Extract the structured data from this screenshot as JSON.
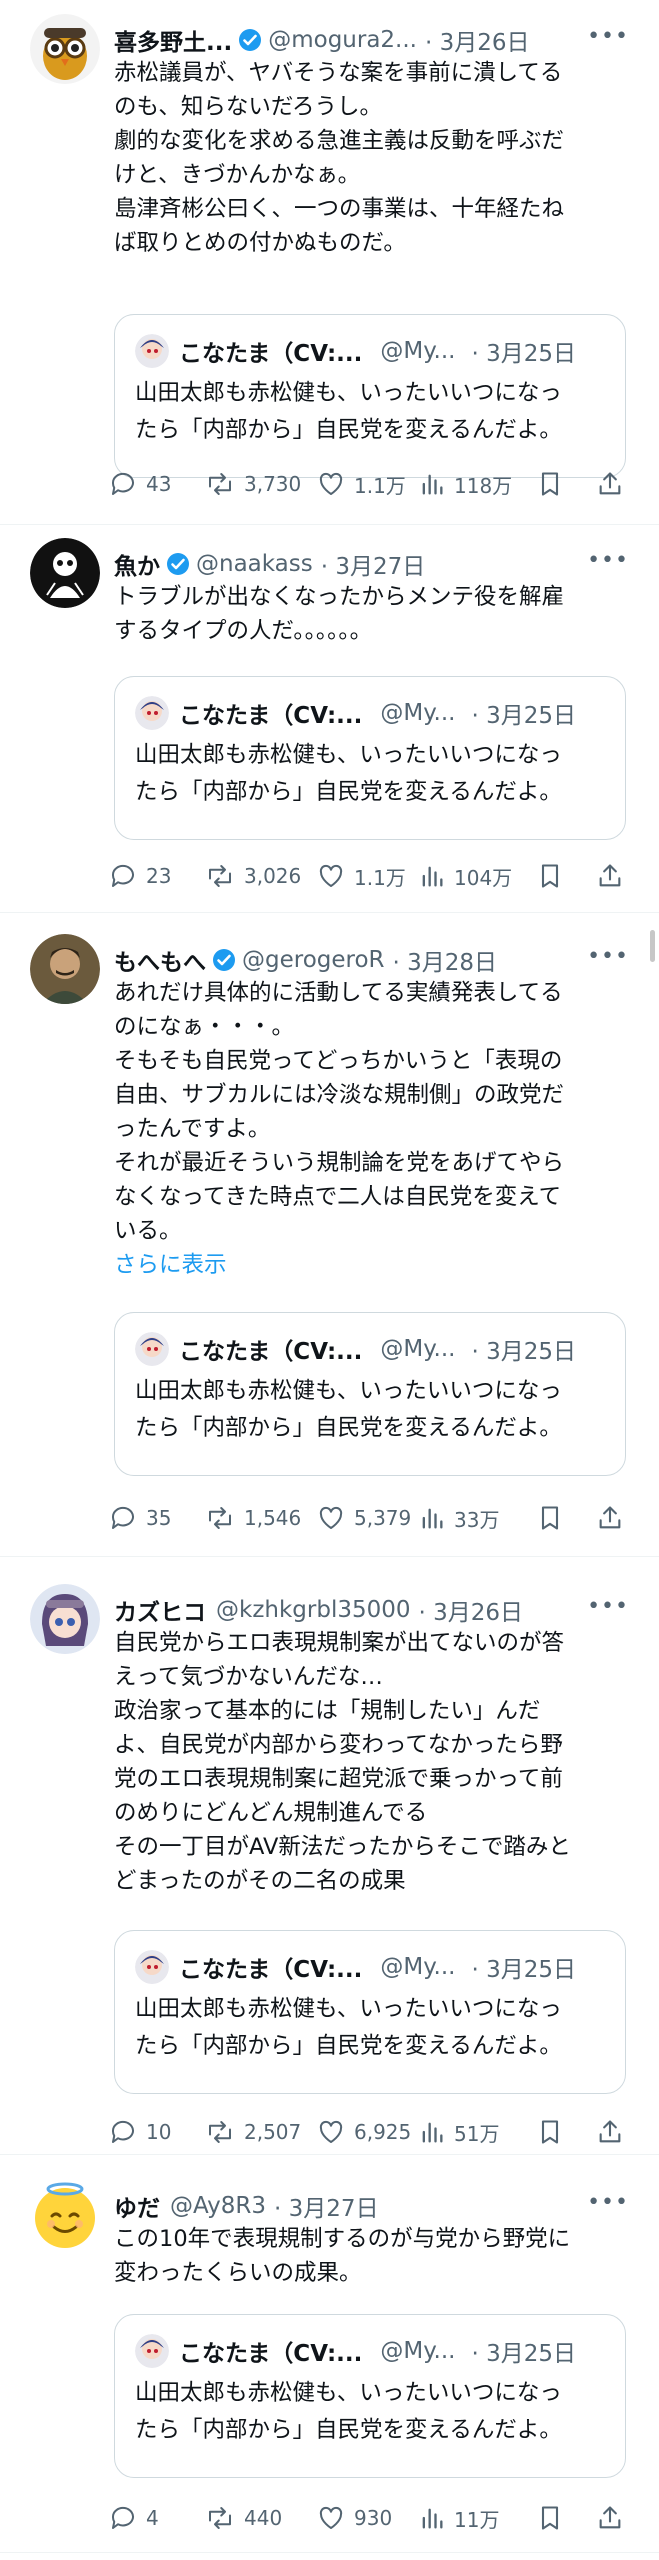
{
  "posts": [
    {
      "name": "喜多野土...",
      "handle": "@mogura2...",
      "date": "· 3月26日",
      "verified": true,
      "avatar": "owl-with-goggles-avatar",
      "lines": [
        "赤松議員が、ヤバそうな案を事前に潰してる",
        "のも、知らないだろうし。",
        "劇的な変化を求める急進主義は反動を呼ぶだ",
        "けと、きづかんかなぁ。",
        "島津斉彬公曰く、一つの事業は、十年経たね",
        "ば取りとめの付かぬものだ。"
      ],
      "show_more": "",
      "quote": {
        "name": "こなたま（CV:...",
        "handle": "@My...",
        "date": "· 3月25日",
        "lines": [
          "山田太郎も赤松健も、いったいいつになっ",
          "たら「内部から」自民党を変えるんだよ。"
        ]
      },
      "replies": "43",
      "reposts": "3,730",
      "likes": "1.1万",
      "views": "118万"
    },
    {
      "name": "魚か",
      "handle": "@naakass",
      "date": "· 3月27日",
      "verified": true,
      "avatar": "black-silhouette-avatar",
      "lines": [
        "トラブルが出なくなったからメンテ役を解雇",
        "するタイプの人だ。。。。。。"
      ],
      "show_more": "",
      "quote": {
        "name": "こなたま（CV:...",
        "handle": "@My...",
        "date": "· 3月25日",
        "lines": [
          "山田太郎も赤松健も、いったいいつになっ",
          "たら「内部から」自民党を変えるんだよ。"
        ]
      },
      "replies": "23",
      "reposts": "3,026",
      "likes": "1.1万",
      "views": "104万"
    },
    {
      "name": "もへもへ",
      "handle": "@gerogeroR",
      "date": "· 3月28日",
      "verified": true,
      "avatar": "portrait-avatar",
      "lines": [
        "あれだけ具体的に活動してる実績発表してる",
        "のになぁ・・・。",
        "そもそも自民党ってどっちかいうと「表現の",
        "自由、サブカルには冷淡な規制側」の政党だ",
        "ったんですよ。",
        "それが最近そういう規制論を党をあげてやら",
        "なくなってきた時点で二人は自民党を変えて",
        "いる。"
      ],
      "show_more": "さらに表示",
      "quote": {
        "name": "こなたま（CV:...",
        "handle": "@My...",
        "date": "· 3月25日",
        "lines": [
          "山田太郎も赤松健も、いったいいつになっ",
          "たら「内部から」自民党を変えるんだよ。"
        ]
      },
      "replies": "35",
      "reposts": "1,546",
      "likes": "5,379",
      "views": "33万"
    },
    {
      "name": "カズヒコ",
      "handle": "@kzhkgrbl35000",
      "date": "· 3月26日",
      "verified": false,
      "avatar": "anime-girl-avatar",
      "lines": [
        "自民党からエロ表現規制案が出てないのが答",
        "えって気づかないんだな…",
        "政治家って基本的には「規制したい」んだ",
        "よ、自民党が内部から変わってなかったら野",
        "党のエロ表現規制案に超党派で乗っかって前",
        "のめりにどんどん規制進んでる",
        "その一丁目がAV新法だったからそこで踏みと",
        "どまったのがその二名の成果"
      ],
      "show_more": "",
      "quote": {
        "name": "こなたま（CV:...",
        "handle": "@My...",
        "date": "· 3月25日",
        "lines": [
          "山田太郎も赤松健も、いったいいつになっ",
          "たら「内部から」自民党を変えるんだよ。"
        ]
      },
      "replies": "10",
      "reposts": "2,507",
      "likes": "6,925",
      "views": "51万"
    },
    {
      "name": "ゆだ",
      "handle": "@Ay8R3",
      "date": "· 3月27日",
      "verified": false,
      "avatar": "halo-smiley-avatar",
      "lines": [
        "この10年で表現規制するのが与党から野党に",
        "変わったくらいの成果。"
      ],
      "show_more": "",
      "quote": {
        "name": "こなたま（CV:...",
        "handle": "@My...",
        "date": "· 3月25日",
        "lines": [
          "山田太郎も赤松健も、いったいいつになっ",
          "たら「内部から」自民党を変えるんだよ。"
        ]
      },
      "replies": "4",
      "reposts": "440",
      "likes": "930",
      "views": "11万"
    }
  ],
  "icons": {
    "reply": "reply-icon",
    "repost": "repost-icon",
    "like": "heart-icon",
    "views": "views-bar-chart-icon",
    "bookmark": "bookmark-icon",
    "share": "share-icon",
    "more": "more-dots-icon",
    "verified": "verified-badge-icon"
  },
  "colors": {
    "text": "#0f1419",
    "muted": "#536471",
    "link": "#1d9bf0",
    "verified": "#1d9bf0",
    "border": "#cfd9de"
  }
}
